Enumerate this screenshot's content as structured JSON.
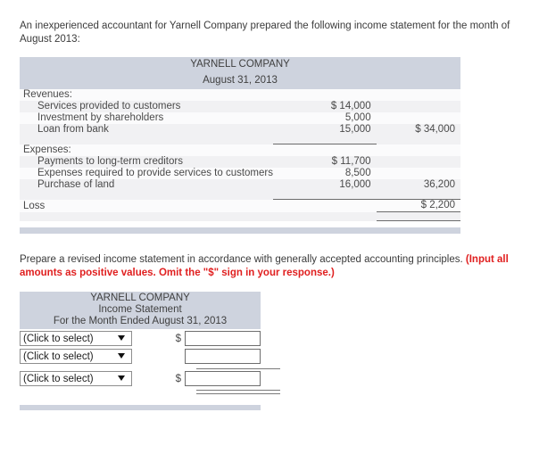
{
  "intro": {
    "text": "An inexperienced accountant for Yarnell Company prepared the following income statement for the month of August 2013:"
  },
  "given_statement": {
    "company": "YARNELL COMPANY",
    "period": "August 31, 2013",
    "sections": [
      {
        "heading": "Revenues:",
        "lines": [
          {
            "label": "Services provided to customers",
            "amount": "$ 14,000",
            "total": ""
          },
          {
            "label": "Investment by shareholders",
            "amount": "5,000",
            "total": ""
          },
          {
            "label": "Loan from bank",
            "amount": "15,000",
            "total": "$ 34,000"
          }
        ]
      },
      {
        "heading": "Expenses:",
        "lines": [
          {
            "label": "Payments to long-term creditors",
            "amount": "$ 11,700",
            "total": ""
          },
          {
            "label": "Expenses required to provide services to customers",
            "amount": "8,500",
            "total": ""
          },
          {
            "label": "Purchase of land",
            "amount": "16,000",
            "total": "36,200"
          }
        ]
      }
    ],
    "result": {
      "label": "Loss",
      "amount": "",
      "total": "$  2,200"
    }
  },
  "prompt": {
    "main": "Prepare a revised income statement in accordance with generally accepted accounting principles.",
    "emphasis": "(Input all amounts as positive values. Omit the \"$\" sign in your response.)"
  },
  "answer_form": {
    "header": {
      "company": "YARNELL COMPANY",
      "statement": "Income Statement",
      "period": "For the Month Ended August 31, 2013"
    },
    "select_placeholder": "(Click to select)",
    "rows": [
      {
        "select": "(Click to select)",
        "dollar": "$",
        "value": ""
      },
      {
        "select": "(Click to select)",
        "dollar": "",
        "value": ""
      },
      {
        "select": "(Click to select)",
        "dollar": "$",
        "value": ""
      }
    ]
  },
  "colors": {
    "header_band": "#ced3de",
    "row_shade": "#f1f1f3",
    "row_plain": "#fbfbfc",
    "emphasis_red": "#e02020",
    "rule": "#6b6b6b"
  }
}
